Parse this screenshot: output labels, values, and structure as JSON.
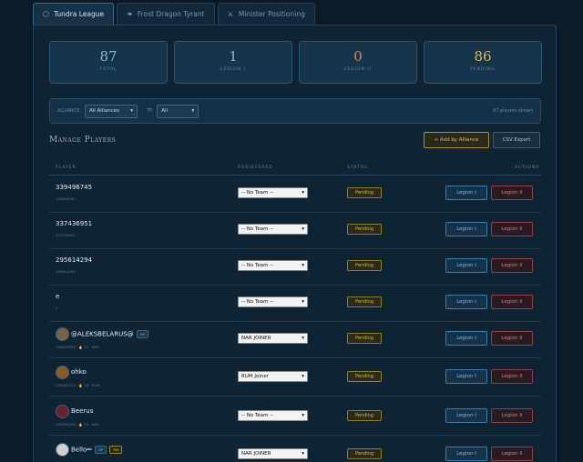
{
  "tabs": [
    {
      "label": "Tundra League",
      "icon": "shield-icon",
      "glyph": "⬡",
      "active": true
    },
    {
      "label": "Frost Dragon Tyrant",
      "icon": "dragon-icon",
      "glyph": "❧",
      "active": false
    },
    {
      "label": "Minister Positioning",
      "icon": "swords-icon",
      "glyph": "⚔",
      "active": false
    }
  ],
  "stats": [
    {
      "value": "87",
      "label": "TOTAL",
      "color": "#7fb6e0"
    },
    {
      "value": "1",
      "label": "LEGION I",
      "color": "#7fb6e0"
    },
    {
      "value": "0",
      "label": "LEGION II",
      "color": "#d9826d"
    },
    {
      "value": "86",
      "label": "PENDING",
      "color": "#d8b85a"
    }
  ],
  "filters": {
    "alliance_label": "ALLIANCE:",
    "alliance_value": "All Alliances",
    "tf_label": "TF:",
    "tf_value": "All",
    "shown": "87 players shown"
  },
  "manage": {
    "title": "Manage Players",
    "add_label": "+ Add by Alliance",
    "csv_label": "CSV Export"
  },
  "columns": {
    "player": "PLAYER",
    "registered": "REGISTERED",
    "status": "STATUS",
    "actions": "ACTIONS"
  },
  "rows": [
    {
      "name": "339496745",
      "id": "339496745",
      "team": "-- No Team --",
      "status": "Pending"
    },
    {
      "name": "337436951",
      "id": "337436951",
      "team": "-- No Team --",
      "status": "Pending"
    },
    {
      "name": "295614294",
      "id": "295614294",
      "team": "-- No Team --",
      "status": "Pending"
    },
    {
      "name": "e",
      "id": "e",
      "team": "-- No Team --",
      "status": "Pending"
    },
    {
      "name": "@ALEKSBELARUS@",
      "id": "336429835 · 🔥 72 · NAR",
      "team": "NAR JOINER",
      "status": "Pending",
      "badge": "HP",
      "avatar": "#7a6048"
    },
    {
      "name": "ohko",
      "id": "335067202 · 🔥 75 · RUM",
      "team": "RUM Joiner",
      "status": "Pending",
      "avatar": "#8a5a2a"
    },
    {
      "name": "Beerus",
      "id": "335930295 · 🔥 74 · NAR",
      "team": "-- No Team --",
      "status": "Pending",
      "avatar": "#6a2030"
    },
    {
      "name": "Bello✏",
      "id": "",
      "team": "NAR JOINER",
      "status": "Pending",
      "badge": "HP",
      "badge2": "HM",
      "avatar": "#d0d0d0"
    }
  ],
  "legion1_label": "Legion I",
  "legion2_label": "Legion II"
}
